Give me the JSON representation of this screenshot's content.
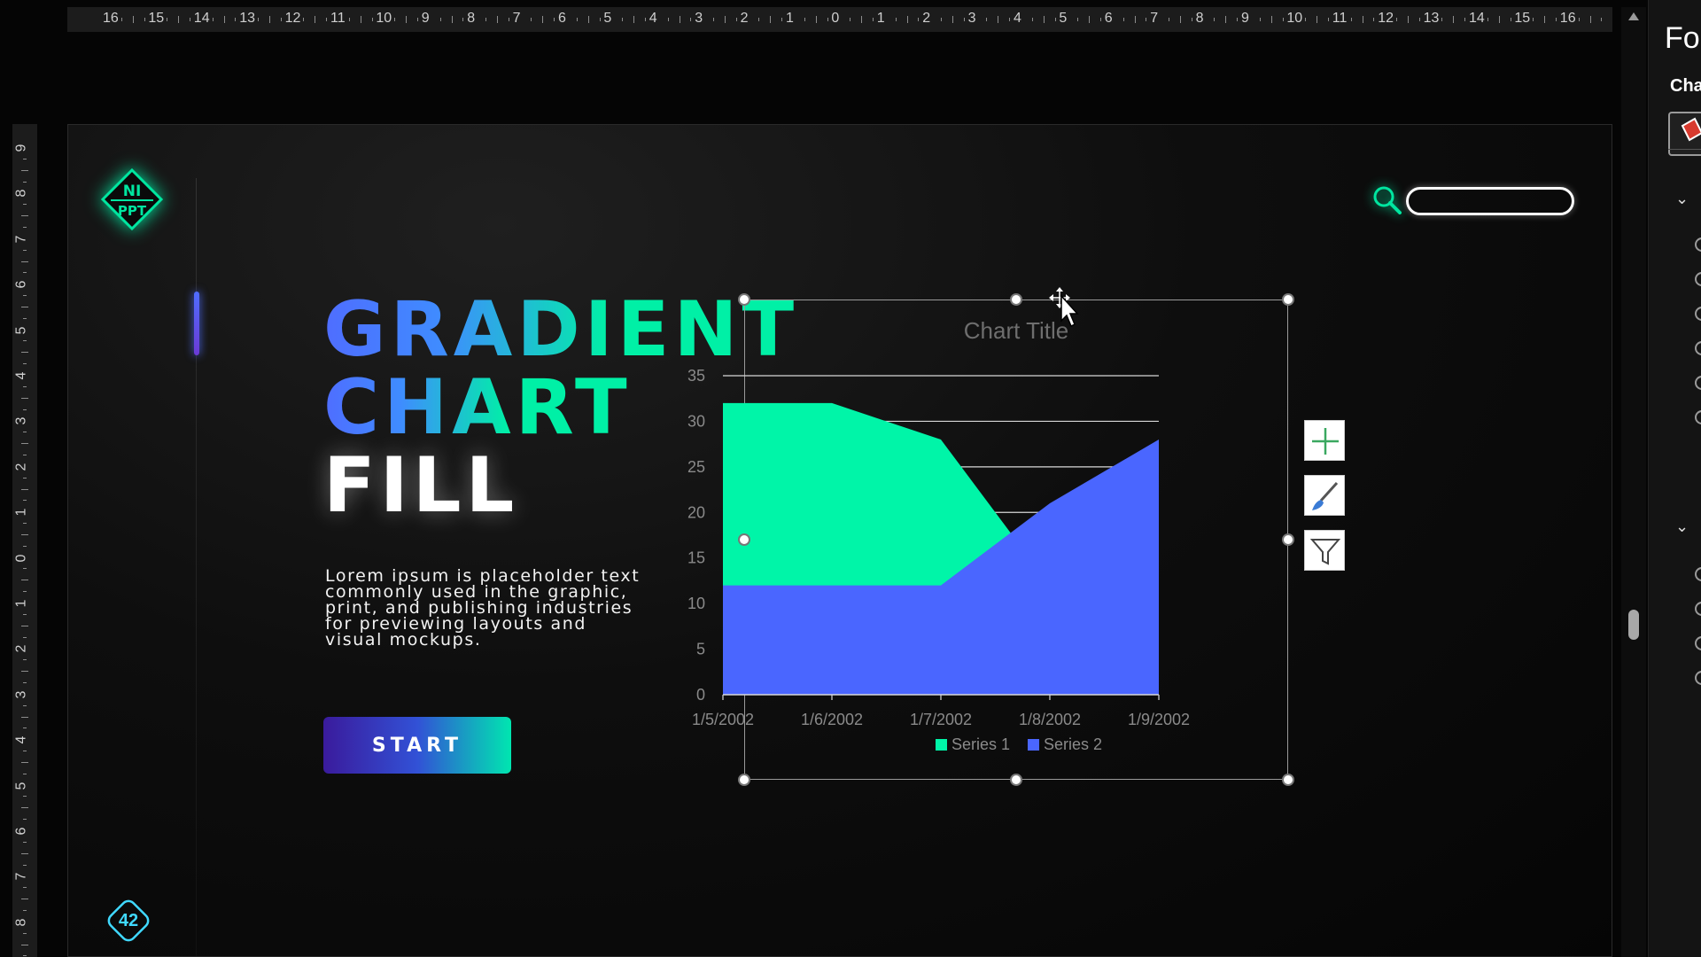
{
  "ruler": {
    "top_labels": [
      "16",
      "15",
      "14",
      "13",
      "12",
      "11",
      "10",
      "9",
      "8",
      "7",
      "6",
      "5",
      "4",
      "3",
      "2",
      "1",
      "0",
      "1",
      "2",
      "3",
      "4",
      "5",
      "6",
      "7",
      "8",
      "9",
      "10",
      "11",
      "12",
      "13",
      "14",
      "15",
      "16"
    ],
    "left_labels": [
      "9",
      "8",
      "7",
      "6",
      "5",
      "4",
      "3",
      "2",
      "1",
      "0",
      "1",
      "2",
      "3",
      "4",
      "5",
      "6",
      "7",
      "8"
    ]
  },
  "format_pane": {
    "title": "For",
    "tab": "Cha"
  },
  "slide": {
    "headline": [
      "GRADIENT",
      "CHART",
      "FILL"
    ],
    "body_lines": [
      "Lorem ipsum is placeholder text",
      "commonly used in the graphic,",
      "print, and publishing industries",
      "for previewing layouts and",
      "visual mockups."
    ],
    "start_label": "START",
    "page_number": "42",
    "search": {
      "value": "",
      "placeholder": ""
    }
  },
  "icons": {
    "logo": "ni-ppt-logo",
    "search": "search-icon",
    "chart_elements": "plus-icon",
    "chart_styles": "paintbrush-icon",
    "chart_filters": "funnel-icon"
  },
  "colors": {
    "series1": "#00f5a8",
    "series2": "#4a66ff",
    "accent_teal": "#00e6a0",
    "accent_blue": "#4f6dff",
    "page_badge": "#40d9ff"
  },
  "chart_data": {
    "type": "area",
    "title": "Chart Title",
    "categories": [
      "1/5/2002",
      "1/6/2002",
      "1/7/2002",
      "1/8/2002",
      "1/9/2002"
    ],
    "series": [
      {
        "name": "Series 1",
        "values": [
          32,
          32,
          28,
          12,
          12
        ]
      },
      {
        "name": "Series 2",
        "values": [
          12,
          12,
          12,
          21,
          28
        ]
      }
    ],
    "ylim": [
      0,
      35
    ],
    "yticks": [
      0,
      5,
      10,
      15,
      20,
      25,
      30,
      35
    ],
    "grid": true,
    "legend": "bottom"
  }
}
